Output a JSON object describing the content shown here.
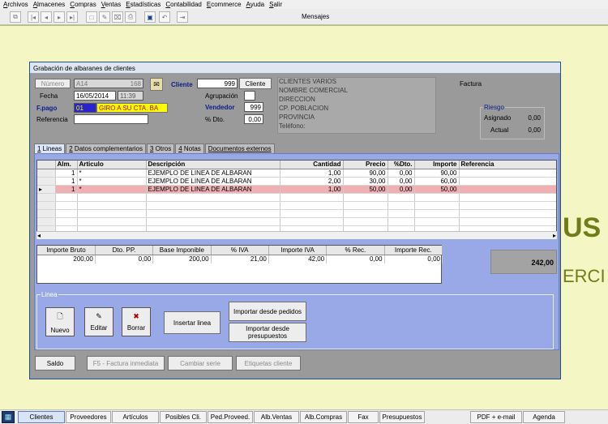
{
  "menu": [
    "Archivos",
    "Almacenes",
    "Compras",
    "Ventas",
    "Estadísticas",
    "Contabilidad",
    "Ecommerce",
    "Ayuda",
    "Salir"
  ],
  "toolbar": {
    "title": "Mensajes",
    "icons": [
      "copy-icon",
      "first-icon",
      "prev-icon",
      "next-icon",
      "last-icon",
      "new-icon",
      "edit-icon",
      "delete-icon",
      "print-icon",
      "save-icon",
      "undo-icon",
      "exit-icon"
    ]
  },
  "background": {
    "big_letters": "US",
    "partial_word": "ERCI"
  },
  "dialog": {
    "title": "Grabación de albaranes de clientes",
    "numero_label": "Número",
    "serie": "A14",
    "numero": "168",
    "fecha_label": "Fecha",
    "fecha": "16/05/2014",
    "hora": "11:39",
    "fpago_label": "F.pago",
    "fpago_code": "01",
    "fpago_desc": "GIRO A SU CTA. BA",
    "referencia_label": "Referencia",
    "referencia": "",
    "cliente_label": "Cliente",
    "cliente_code": "999",
    "cliente_button": "Cliente",
    "agrupacion_label": "Agrupación",
    "agrupacion": "",
    "vendedor_label": "Vendedor",
    "vendedor": "999",
    "dto_label": "% Dto.",
    "dto": "0,00",
    "client_info": [
      "CLIENTES VARIOS",
      "NOMBRE COMERCIAL",
      "DIRECCION",
      "CP. POBLACION",
      "PROVINCIA",
      "Teléfono:"
    ],
    "factura_label": "Factura",
    "riesgo": {
      "title": "Riesgo",
      "asignado_label": "Asignado",
      "asignado": "0,00",
      "actual_label": "Actual",
      "actual": "0,00"
    },
    "tabs": [
      {
        "key": "1",
        "label": " Lineas"
      },
      {
        "key": "2",
        "label": " Datos complementarios"
      },
      {
        "key": "3",
        "label": " Otros"
      },
      {
        "key": "4",
        "label": " Notas"
      },
      {
        "key": "",
        "label": "Documentos externos"
      }
    ],
    "grid": {
      "headers": [
        "Alm.",
        "Articulo",
        "Descripción",
        "Cantidad",
        "Precio",
        "%Dto.",
        "Importe",
        "Referencia"
      ],
      "rows": [
        [
          "1",
          "*",
          "EJEMPLO DE LINEA DE ALBARAN",
          "1,00",
          "90,00",
          "0,00",
          "90,00",
          ""
        ],
        [
          "1",
          "*",
          "EJEMPLO DE LINEA DE ALBARAN",
          "2,00",
          "30,00",
          "0,00",
          "60,00",
          ""
        ],
        [
          "1",
          "*",
          "EJEMPLO DE LINEA DE ALBARAN",
          "1,00",
          "50,00",
          "0,00",
          "50,00",
          ""
        ]
      ],
      "selected_row": 2
    },
    "totals": {
      "headers": [
        "Importe Bruto",
        "Dto. PP.",
        "Base Imponible",
        "% IVA",
        "Importe IVA",
        "% Rec.",
        "Importe Rec."
      ],
      "values": [
        "200,00",
        "0,00",
        "200,00",
        "21,00",
        "42,00",
        "0,00",
        "0,00"
      ],
      "grand_total": "242,00"
    },
    "linea": {
      "title": "Linea",
      "nuevo": "Nuevo",
      "editar": "Editar",
      "borrar": "Borrar",
      "insertar": "Insertar linea",
      "importar_pedidos": "Importar desde pedidos",
      "importar_presupuestos": "Importar desde presupuestos"
    },
    "bottom_buttons": {
      "saldo": "Saldo",
      "factura_inmediata": "F5 - Factura inmediata",
      "cambiar_serie": "Cambiar serie",
      "etiquetas": "Etiquetas cliente"
    }
  },
  "taskbar": [
    "Clientes",
    "Proveedores",
    "Artículos",
    "Posibles Cli.",
    "Ped.Proveed.",
    "Alb.Ventas",
    "Alb.Compras",
    "Fax",
    "Presupuestos",
    "PDF + e-mail",
    "Agenda"
  ]
}
